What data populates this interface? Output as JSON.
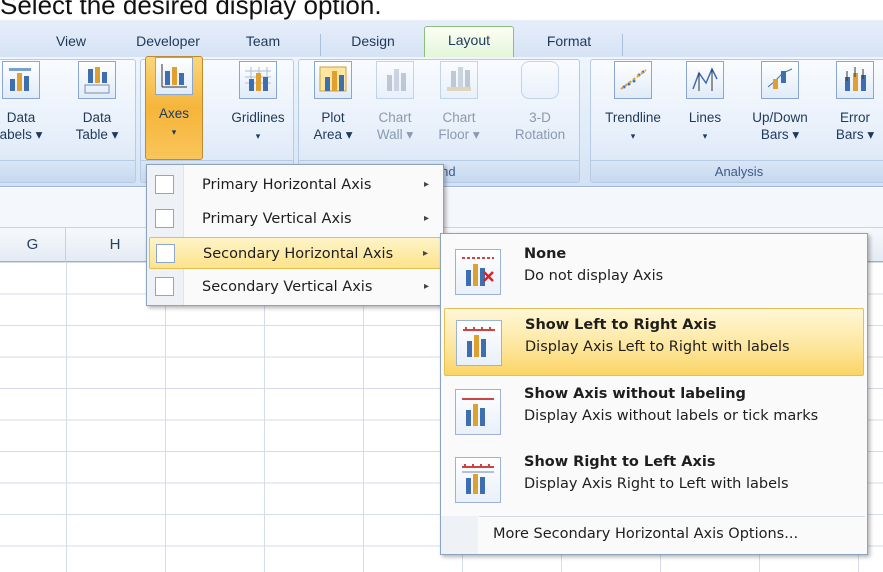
{
  "instruction": "Select the desired display option.",
  "tabs": [
    "View",
    "Developer",
    "Team",
    "Design",
    "Layout",
    "Format"
  ],
  "active_tab": "Layout",
  "ribbon": {
    "buttons": [
      {
        "line1": "Data",
        "line2": "abels ▾"
      },
      {
        "line1": "Data",
        "line2": "Table ▾"
      },
      {
        "line1": "Axes",
        "line2": "▾"
      },
      {
        "line1": "Gridlines",
        "line2": "▾"
      },
      {
        "line1": "Plot",
        "line2": "Area ▾"
      },
      {
        "line1": "Chart",
        "line2": "Wall ▾"
      },
      {
        "line1": "Chart",
        "line2": "Floor ▾"
      },
      {
        "line1": "3-D",
        "line2": "Rotation"
      },
      {
        "line1": "Trendline",
        "line2": "▾"
      },
      {
        "line1": "Lines",
        "line2": "▾"
      },
      {
        "line1": "Up/Down",
        "line2": "Bars ▾"
      },
      {
        "line1": "Error",
        "line2": "Bars ▾"
      }
    ],
    "groups": {
      "background": "round",
      "analysis": "Analysis"
    }
  },
  "columns": [
    "G",
    "H"
  ],
  "axes_menu": {
    "items": [
      {
        "label": "Primary Horizontal Axis",
        "arrow": "▸"
      },
      {
        "label": "Primary Vertical Axis",
        "arrow": "▸"
      },
      {
        "label": "Secondary Horizontal Axis",
        "arrow": "▸"
      },
      {
        "label": "Secondary Vertical Axis",
        "arrow": "▸"
      }
    ],
    "highlighted": "Secondary Horizontal Axis"
  },
  "secondary_horizontal_menu": {
    "options": [
      {
        "title": "None",
        "description": "Do not display Axis"
      },
      {
        "title": "Show Left to Right Axis",
        "description": "Display Axis Left to Right with labels"
      },
      {
        "title": "Show Axis without labeling",
        "description": "Display Axis without labels or tick marks"
      },
      {
        "title": "Show Right to Left Axis",
        "description": "Display Axis Right to Left with labels"
      }
    ],
    "highlighted": "Show Left to Right Axis",
    "more_options": "More Secondary Horizontal Axis Options..."
  },
  "colors": {
    "highlight": "#fde38a",
    "ribbon": "#dde9f8",
    "pressed": "#f5b53a"
  }
}
